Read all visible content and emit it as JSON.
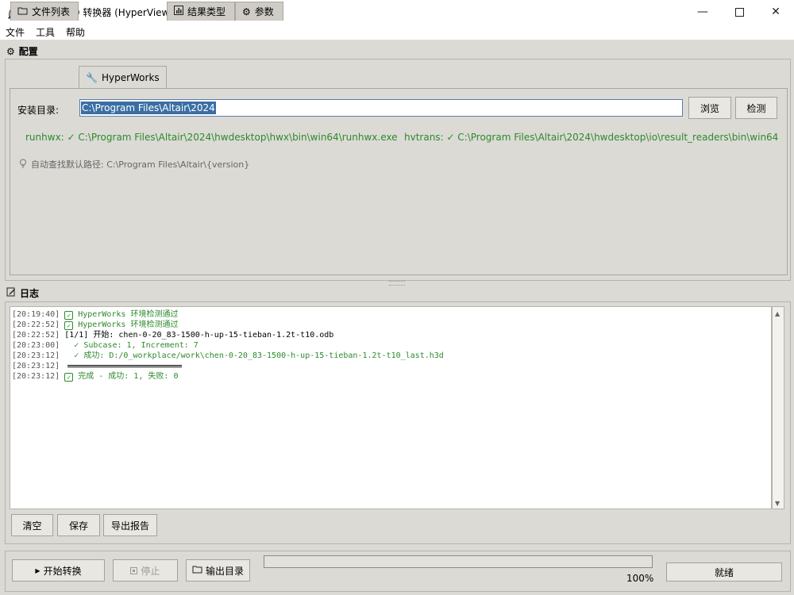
{
  "window": {
    "title": "ODB → H3D 转换器 (HyperView API)",
    "minimize_icon": "minimize-icon",
    "maximize_icon": "maximize-icon",
    "close_icon": "close-icon"
  },
  "menu": [
    "文件",
    "工具",
    "帮助"
  ],
  "config": {
    "section_label": "配置",
    "tabs": [
      {
        "label": "文件列表",
        "icon": "folder-icon"
      },
      {
        "label": "HyperWorks",
        "icon": "wrench-icon"
      },
      {
        "label": "结果类型",
        "icon": "bar-chart-icon"
      },
      {
        "label": "参数",
        "icon": "gear-icon"
      }
    ],
    "active_tab": "HyperWorks",
    "install_dir_label": "安装目录:",
    "install_dir_value": "C:\\Program Files\\Altair\\2024",
    "browse_label": "浏览",
    "detect_label": "检测",
    "runhwx_status": "runhwx: ✓ C:\\Program Files\\Altair\\2024\\hwdesktop\\hwx\\bin\\win64\\runhwx.exe",
    "hvtrans_status": "hvtrans: ✓ C:\\Program Files\\Altair\\2024\\hwdesktop\\io\\result_readers\\bin\\win64",
    "hint": "自动查找默认路径: C:\\Program Files\\Altair\\{version}",
    "status_color": "#2d8a2d"
  },
  "log": {
    "section_label": "日志",
    "lines": [
      {
        "ts": "[20:19:40]",
        "check": true,
        "text": "HyperWorks 环境检测通过",
        "style": "green"
      },
      {
        "ts": "[20:22:52]",
        "check": true,
        "text": "HyperWorks 环境检测通过",
        "style": "green"
      },
      {
        "ts": "[20:22:52]",
        "check": false,
        "text": "[1/1] 开始: chen-0-20_83-1500-h-up-15-tieban-1.2t-t10.odb",
        "style": "black"
      },
      {
        "ts": "[20:23:00]",
        "check": false,
        "text": "  ✓ Subcase: 1, Increment: 7",
        "style": "green"
      },
      {
        "ts": "[20:23:12]",
        "check": false,
        "text": "  ✓ 成功: D:/0_workplace/work\\chen-0-20_83-1500-h-up-15-tieban-1.2t-t10_last.h3d",
        "style": "green"
      },
      {
        "ts": "[20:23:12]",
        "check": false,
        "text": "",
        "style": "rule"
      },
      {
        "ts": "[20:23:12]",
        "check": true,
        "text": "完成 - 成功: 1, 失败: 0",
        "style": "green"
      }
    ],
    "clear_label": "清空",
    "save_label": "保存",
    "export_label": "导出报告"
  },
  "controls": {
    "start_label": "开始转换",
    "stop_label": "停止",
    "output_dir_label": "输出目录",
    "progress_percent": 100,
    "progress_text": "100%",
    "status_text": "就绪"
  }
}
